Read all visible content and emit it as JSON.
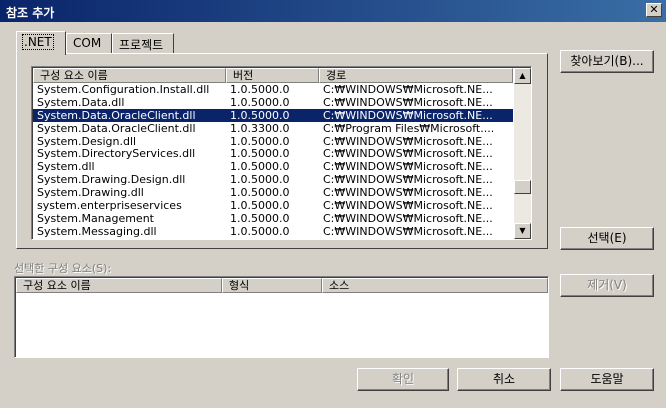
{
  "window": {
    "title": "참조 추가",
    "close_glyph": "✕"
  },
  "tabs": [
    {
      "label": ".NET",
      "active": true
    },
    {
      "label": "COM",
      "active": false
    },
    {
      "label": "프로젝트",
      "active": false
    }
  ],
  "buttons": {
    "browse": "찾아보기(B)...",
    "select": "선택(E)",
    "remove": "제거(V)",
    "ok": "확인",
    "cancel": "취소",
    "help": "도움말"
  },
  "components_list": {
    "columns": [
      "구성 요소 이름",
      "버전",
      "경로"
    ],
    "rows": [
      [
        "System.Configuration.Install.dll",
        "1.0.5000.0",
        "C:₩WINDOWS₩Microsoft.NE..."
      ],
      [
        "System.Data.dll",
        "1.0.5000.0",
        "C:₩WINDOWS₩Microsoft.NE..."
      ],
      [
        "System.Data.OracleClient.dll",
        "1.0.5000.0",
        "C:₩WINDOWS₩Microsoft.NE..."
      ],
      [
        "System.Data.OracleClient.dll",
        "1.0.3300.0",
        "C:₩Program Files₩Microsoft...."
      ],
      [
        "System.Design.dll",
        "1.0.5000.0",
        "C:₩WINDOWS₩Microsoft.NE..."
      ],
      [
        "System.DirectoryServices.dll",
        "1.0.5000.0",
        "C:₩WINDOWS₩Microsoft.NE..."
      ],
      [
        "System.dll",
        "1.0.5000.0",
        "C:₩WINDOWS₩Microsoft.NE..."
      ],
      [
        "System.Drawing.Design.dll",
        "1.0.5000.0",
        "C:₩WINDOWS₩Microsoft.NE..."
      ],
      [
        "System.Drawing.dll",
        "1.0.5000.0",
        "C:₩WINDOWS₩Microsoft.NE..."
      ],
      [
        "system.enterpriseservices",
        "1.0.5000.0",
        "C:₩WINDOWS₩Microsoft.NE..."
      ],
      [
        "System.Management",
        "1.0.5000.0",
        "C:₩WINDOWS₩Microsoft.NE..."
      ],
      [
        "System.Messaging.dll",
        "1.0.5000.0",
        "C:₩WINDOWS₩Microsoft.NE..."
      ]
    ],
    "selected_index": 2
  },
  "selected_section": {
    "label": "선택한 구성 요소(S):",
    "columns": [
      "구성 요소 이름",
      "형식",
      "소스"
    ]
  },
  "scrollbar": {
    "up_glyph": "▲",
    "down_glyph": "▼"
  }
}
